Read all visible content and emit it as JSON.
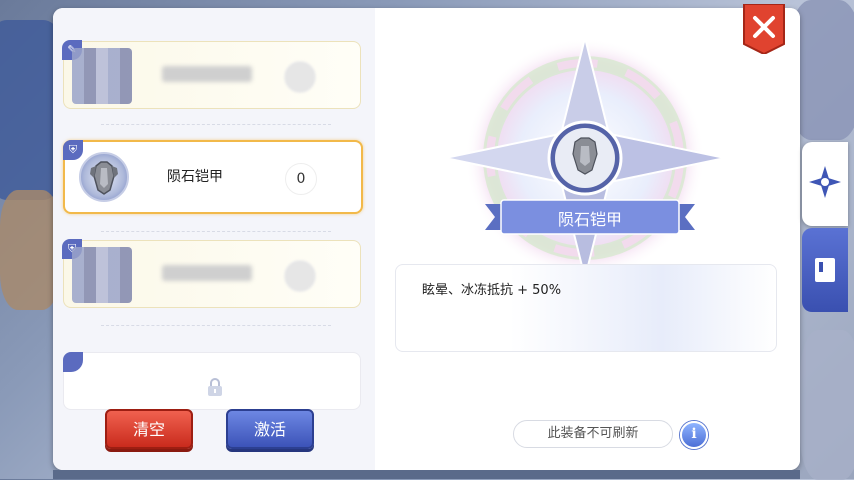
{
  "slots": [
    {
      "name": "",
      "count": "",
      "blurred": true
    },
    {
      "name": "陨石铠甲",
      "count": "0",
      "blurred": false,
      "selected": true
    },
    {
      "name": "",
      "count": "",
      "blurred": true
    }
  ],
  "locked_slot": {
    "icon": "lock-icon"
  },
  "buttons": {
    "clear": "清空",
    "activate": "激活"
  },
  "detail": {
    "item_name": "陨石铠甲",
    "effect": "眩晕、冰冻抵抗 + 50%",
    "no_refresh": "此装备不可刷新",
    "info_icon_text": "i"
  },
  "colors": {
    "accent_blue": "#5b6bbf",
    "select_gold": "#f2b94a",
    "close_red": "#e0432f"
  }
}
